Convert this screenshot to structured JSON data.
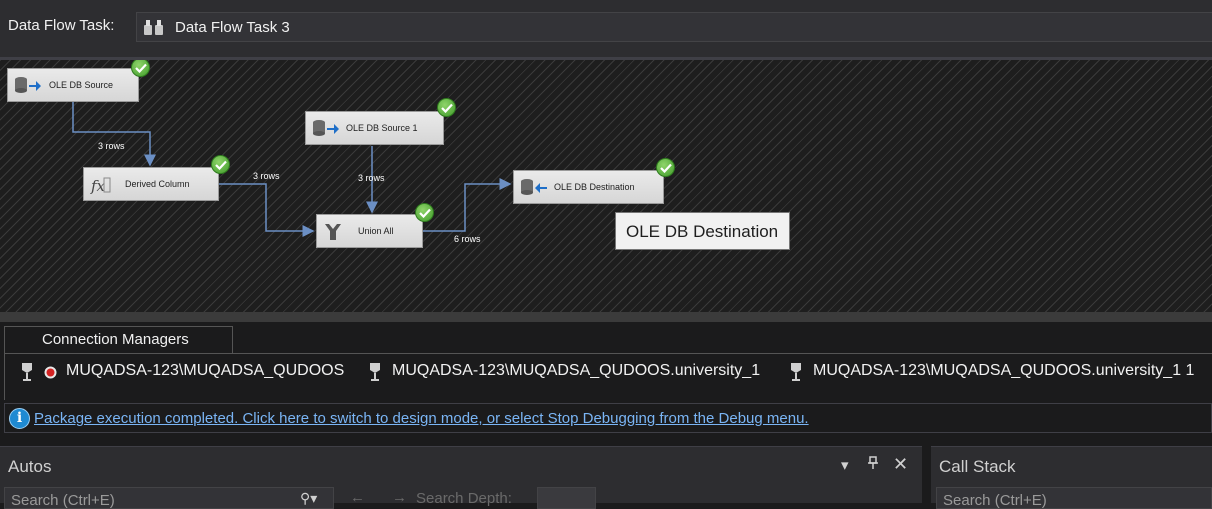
{
  "topbar": {
    "label": "Data Flow Task:",
    "selected_task": "Data Flow Task 3"
  },
  "nodes": [
    {
      "id": "src",
      "label": "OLE DB Source",
      "status": "success"
    },
    {
      "id": "dc",
      "label": "Derived Column",
      "status": "success"
    },
    {
      "id": "src1",
      "label": "OLE DB Source 1",
      "status": "success"
    },
    {
      "id": "ua",
      "label": "Union All",
      "status": "success"
    },
    {
      "id": "dest",
      "label": "OLE DB Destination",
      "status": "success"
    }
  ],
  "paths": [
    {
      "from": "OLE DB Source",
      "to": "Derived Column",
      "rows": "3 rows"
    },
    {
      "from": "Derived Column",
      "to": "Union All",
      "rows": "3 rows"
    },
    {
      "from": "OLE DB Source 1",
      "to": "Union All",
      "rows": "3 rows"
    },
    {
      "from": "Union All",
      "to": "OLE DB Destination",
      "rows": "6 rows"
    }
  ],
  "tooltip": "OLE DB Destination",
  "connection_managers": {
    "tab_label": "Connection Managers",
    "items": [
      {
        "label": "MUQADSA-123\\MUQADSA_QUDOOS",
        "has_error_badge": true
      },
      {
        "label": "MUQADSA-123\\MUQADSA_QUDOOS.university_1",
        "has_error_badge": false
      },
      {
        "label": "MUQADSA-123\\MUQADSA_QUDOOS.university_1 1",
        "has_error_badge": false
      }
    ]
  },
  "infobar": {
    "message": "Package execution completed. Click here to switch to design mode, or select Stop Debugging from the Debug menu."
  },
  "autos_pane": {
    "title": "Autos",
    "search_placeholder": "Search (Ctrl+E)",
    "search_depth_label": "Search Depth:"
  },
  "call_stack_pane": {
    "title": "Call Stack",
    "search_placeholder": "Search (Ctrl+E)"
  },
  "colors": {
    "success": "#4caf32",
    "link": "#7ab5f5",
    "info": "#1f8ad2",
    "connector": "#6b8fc4"
  }
}
